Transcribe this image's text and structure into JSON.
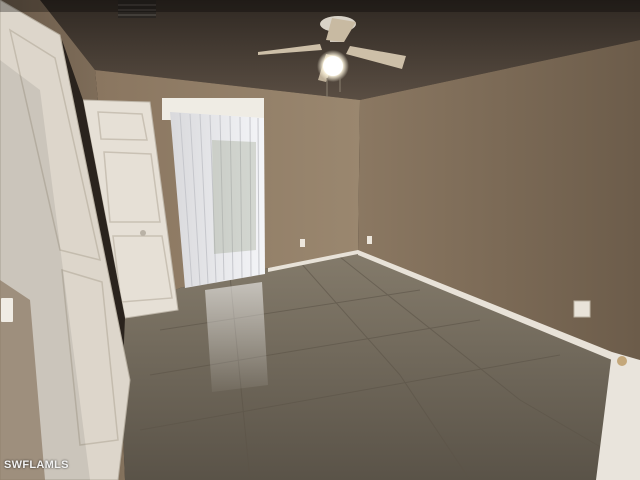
{
  "photo": {
    "watermark": "SWFLAMLS",
    "subject": "empty-bedroom-interior"
  },
  "colors": {
    "wall_left": "#7c6a55",
    "wall_back": "#8a7862",
    "wall_right": "#7f6d57",
    "ceiling": "#4a4038",
    "floor": "#6e6658",
    "baseboard": "#e8e2d8",
    "door": "#e6e0d6",
    "blinds": "#e9eaee"
  },
  "icons": [
    "ceiling-fan-icon",
    "light-bulb-icon",
    "air-vent-icon",
    "power-outlet-icon"
  ]
}
